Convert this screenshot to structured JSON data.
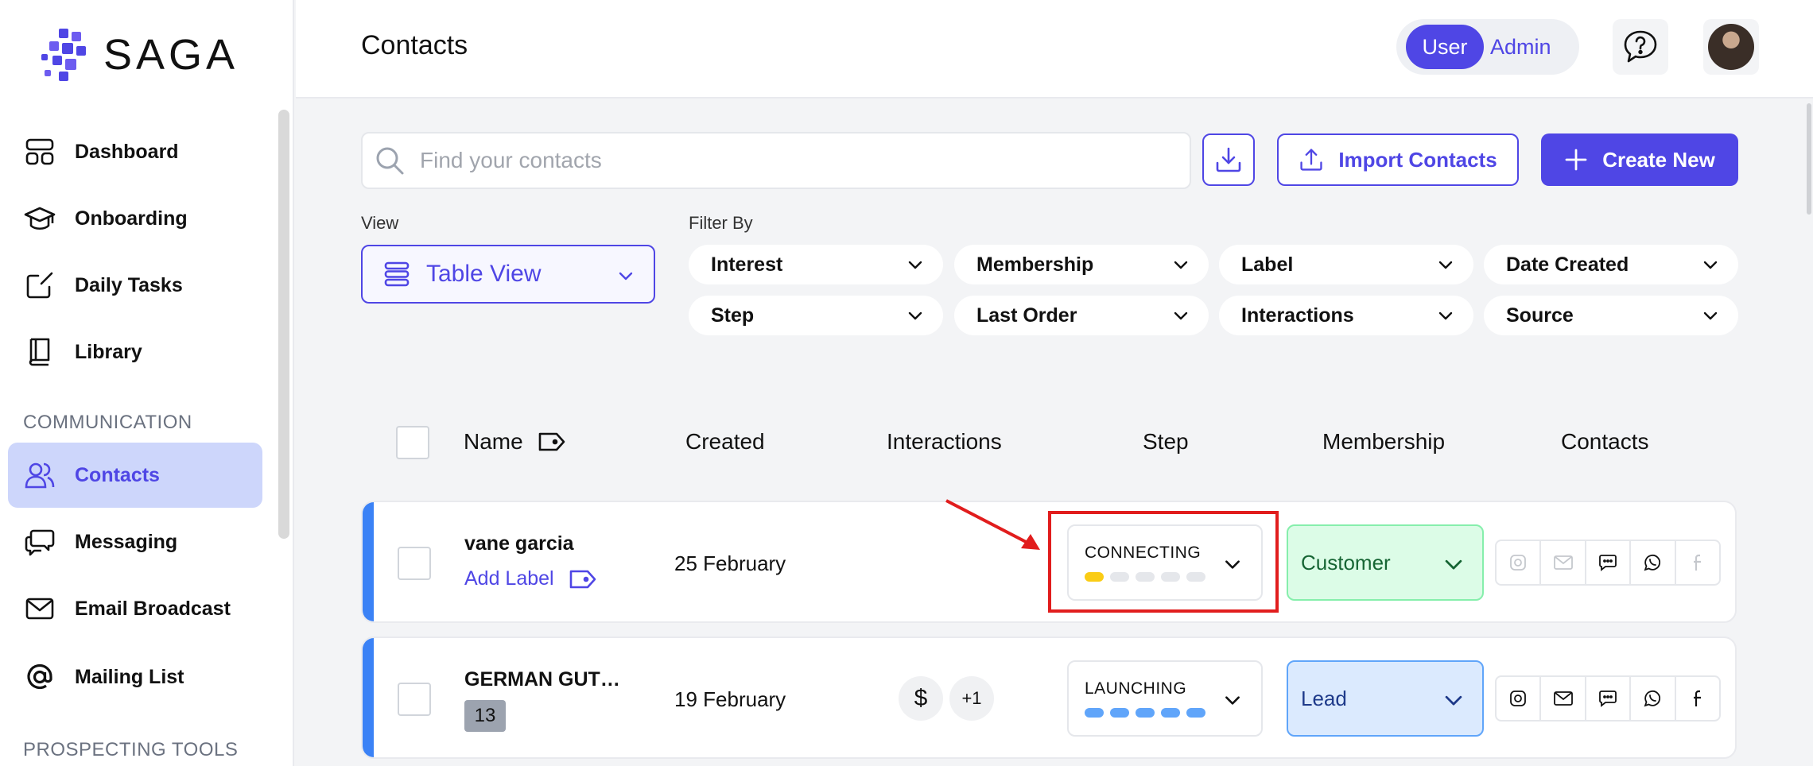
{
  "app": {
    "brand": "SAGA"
  },
  "sidebar": {
    "items": [
      {
        "label": "Dashboard"
      },
      {
        "label": "Onboarding"
      },
      {
        "label": "Daily Tasks"
      },
      {
        "label": "Library"
      }
    ],
    "section_communication": "COMMUNICATION",
    "comm_items": [
      {
        "label": "Contacts"
      },
      {
        "label": "Messaging"
      },
      {
        "label": "Email Broadcast"
      },
      {
        "label": "Mailing List"
      }
    ],
    "section_prospecting": "PROSPECTING TOOLS"
  },
  "header": {
    "title": "Contacts",
    "role_user": "User",
    "role_admin": "Admin"
  },
  "toolbar": {
    "search_placeholder": "Find your contacts",
    "import_label": "Import Contacts",
    "create_label": "Create New"
  },
  "view": {
    "label": "View",
    "selected": "Table View"
  },
  "filters": {
    "label": "Filter By",
    "items": [
      "Interest",
      "Membership",
      "Label",
      "Date Created",
      "Step",
      "Last Order",
      "Interactions",
      "Source"
    ]
  },
  "table": {
    "headers": [
      "Name",
      "Created",
      "Interactions",
      "Step",
      "Membership",
      "Contacts"
    ],
    "rows": [
      {
        "name": "vane garcia",
        "add_label": "Add Label",
        "created": "25 February",
        "step": "CONNECTING",
        "step_progress": 1,
        "step_color": "#facc15",
        "membership": "Customer"
      },
      {
        "name": "GERMAN GUT…",
        "badge": "13",
        "created": "19 February",
        "interaction_icon": "$",
        "interaction_more": "+1",
        "step": "LAUNCHING",
        "step_progress": 5,
        "step_color": "#60a5fa",
        "membership": "Lead"
      }
    ]
  },
  "colors": {
    "accent": "#4f46e5",
    "row_accent": "#3b82f6",
    "highlight": "#e11d1d"
  }
}
